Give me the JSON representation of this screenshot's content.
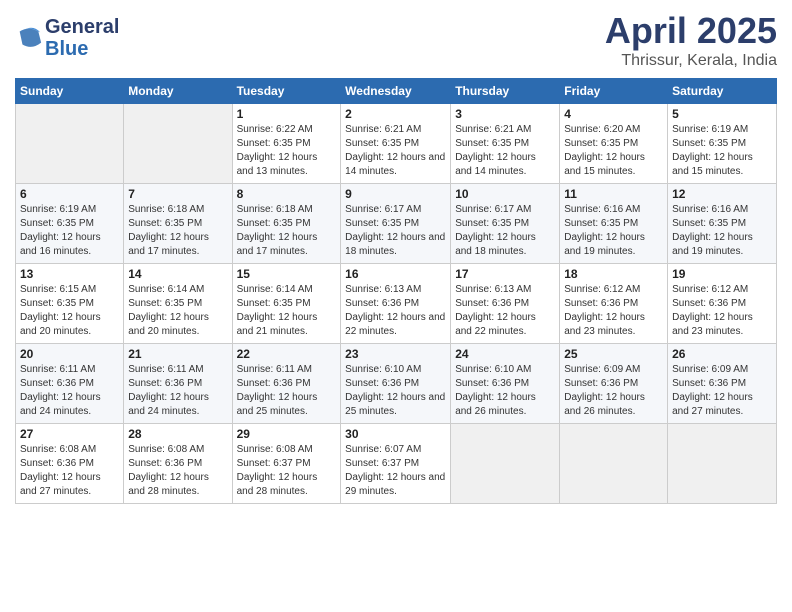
{
  "header": {
    "logo_line1": "General",
    "logo_line2": "Blue",
    "month": "April 2025",
    "location": "Thrissur, Kerala, India"
  },
  "days_of_week": [
    "Sunday",
    "Monday",
    "Tuesday",
    "Wednesday",
    "Thursday",
    "Friday",
    "Saturday"
  ],
  "weeks": [
    [
      {
        "day": "",
        "sunrise": "",
        "sunset": "",
        "daylight": ""
      },
      {
        "day": "",
        "sunrise": "",
        "sunset": "",
        "daylight": ""
      },
      {
        "day": "1",
        "sunrise": "Sunrise: 6:22 AM",
        "sunset": "Sunset: 6:35 PM",
        "daylight": "Daylight: 12 hours and 13 minutes."
      },
      {
        "day": "2",
        "sunrise": "Sunrise: 6:21 AM",
        "sunset": "Sunset: 6:35 PM",
        "daylight": "Daylight: 12 hours and 14 minutes."
      },
      {
        "day": "3",
        "sunrise": "Sunrise: 6:21 AM",
        "sunset": "Sunset: 6:35 PM",
        "daylight": "Daylight: 12 hours and 14 minutes."
      },
      {
        "day": "4",
        "sunrise": "Sunrise: 6:20 AM",
        "sunset": "Sunset: 6:35 PM",
        "daylight": "Daylight: 12 hours and 15 minutes."
      },
      {
        "day": "5",
        "sunrise": "Sunrise: 6:19 AM",
        "sunset": "Sunset: 6:35 PM",
        "daylight": "Daylight: 12 hours and 15 minutes."
      }
    ],
    [
      {
        "day": "6",
        "sunrise": "Sunrise: 6:19 AM",
        "sunset": "Sunset: 6:35 PM",
        "daylight": "Daylight: 12 hours and 16 minutes."
      },
      {
        "day": "7",
        "sunrise": "Sunrise: 6:18 AM",
        "sunset": "Sunset: 6:35 PM",
        "daylight": "Daylight: 12 hours and 17 minutes."
      },
      {
        "day": "8",
        "sunrise": "Sunrise: 6:18 AM",
        "sunset": "Sunset: 6:35 PM",
        "daylight": "Daylight: 12 hours and 17 minutes."
      },
      {
        "day": "9",
        "sunrise": "Sunrise: 6:17 AM",
        "sunset": "Sunset: 6:35 PM",
        "daylight": "Daylight: 12 hours and 18 minutes."
      },
      {
        "day": "10",
        "sunrise": "Sunrise: 6:17 AM",
        "sunset": "Sunset: 6:35 PM",
        "daylight": "Daylight: 12 hours and 18 minutes."
      },
      {
        "day": "11",
        "sunrise": "Sunrise: 6:16 AM",
        "sunset": "Sunset: 6:35 PM",
        "daylight": "Daylight: 12 hours and 19 minutes."
      },
      {
        "day": "12",
        "sunrise": "Sunrise: 6:16 AM",
        "sunset": "Sunset: 6:35 PM",
        "daylight": "Daylight: 12 hours and 19 minutes."
      }
    ],
    [
      {
        "day": "13",
        "sunrise": "Sunrise: 6:15 AM",
        "sunset": "Sunset: 6:35 PM",
        "daylight": "Daylight: 12 hours and 20 minutes."
      },
      {
        "day": "14",
        "sunrise": "Sunrise: 6:14 AM",
        "sunset": "Sunset: 6:35 PM",
        "daylight": "Daylight: 12 hours and 20 minutes."
      },
      {
        "day": "15",
        "sunrise": "Sunrise: 6:14 AM",
        "sunset": "Sunset: 6:35 PM",
        "daylight": "Daylight: 12 hours and 21 minutes."
      },
      {
        "day": "16",
        "sunrise": "Sunrise: 6:13 AM",
        "sunset": "Sunset: 6:36 PM",
        "daylight": "Daylight: 12 hours and 22 minutes."
      },
      {
        "day": "17",
        "sunrise": "Sunrise: 6:13 AM",
        "sunset": "Sunset: 6:36 PM",
        "daylight": "Daylight: 12 hours and 22 minutes."
      },
      {
        "day": "18",
        "sunrise": "Sunrise: 6:12 AM",
        "sunset": "Sunset: 6:36 PM",
        "daylight": "Daylight: 12 hours and 23 minutes."
      },
      {
        "day": "19",
        "sunrise": "Sunrise: 6:12 AM",
        "sunset": "Sunset: 6:36 PM",
        "daylight": "Daylight: 12 hours and 23 minutes."
      }
    ],
    [
      {
        "day": "20",
        "sunrise": "Sunrise: 6:11 AM",
        "sunset": "Sunset: 6:36 PM",
        "daylight": "Daylight: 12 hours and 24 minutes."
      },
      {
        "day": "21",
        "sunrise": "Sunrise: 6:11 AM",
        "sunset": "Sunset: 6:36 PM",
        "daylight": "Daylight: 12 hours and 24 minutes."
      },
      {
        "day": "22",
        "sunrise": "Sunrise: 6:11 AM",
        "sunset": "Sunset: 6:36 PM",
        "daylight": "Daylight: 12 hours and 25 minutes."
      },
      {
        "day": "23",
        "sunrise": "Sunrise: 6:10 AM",
        "sunset": "Sunset: 6:36 PM",
        "daylight": "Daylight: 12 hours and 25 minutes."
      },
      {
        "day": "24",
        "sunrise": "Sunrise: 6:10 AM",
        "sunset": "Sunset: 6:36 PM",
        "daylight": "Daylight: 12 hours and 26 minutes."
      },
      {
        "day": "25",
        "sunrise": "Sunrise: 6:09 AM",
        "sunset": "Sunset: 6:36 PM",
        "daylight": "Daylight: 12 hours and 26 minutes."
      },
      {
        "day": "26",
        "sunrise": "Sunrise: 6:09 AM",
        "sunset": "Sunset: 6:36 PM",
        "daylight": "Daylight: 12 hours and 27 minutes."
      }
    ],
    [
      {
        "day": "27",
        "sunrise": "Sunrise: 6:08 AM",
        "sunset": "Sunset: 6:36 PM",
        "daylight": "Daylight: 12 hours and 27 minutes."
      },
      {
        "day": "28",
        "sunrise": "Sunrise: 6:08 AM",
        "sunset": "Sunset: 6:36 PM",
        "daylight": "Daylight: 12 hours and 28 minutes."
      },
      {
        "day": "29",
        "sunrise": "Sunrise: 6:08 AM",
        "sunset": "Sunset: 6:37 PM",
        "daylight": "Daylight: 12 hours and 28 minutes."
      },
      {
        "day": "30",
        "sunrise": "Sunrise: 6:07 AM",
        "sunset": "Sunset: 6:37 PM",
        "daylight": "Daylight: 12 hours and 29 minutes."
      },
      {
        "day": "",
        "sunrise": "",
        "sunset": "",
        "daylight": ""
      },
      {
        "day": "",
        "sunrise": "",
        "sunset": "",
        "daylight": ""
      },
      {
        "day": "",
        "sunrise": "",
        "sunset": "",
        "daylight": ""
      }
    ]
  ]
}
